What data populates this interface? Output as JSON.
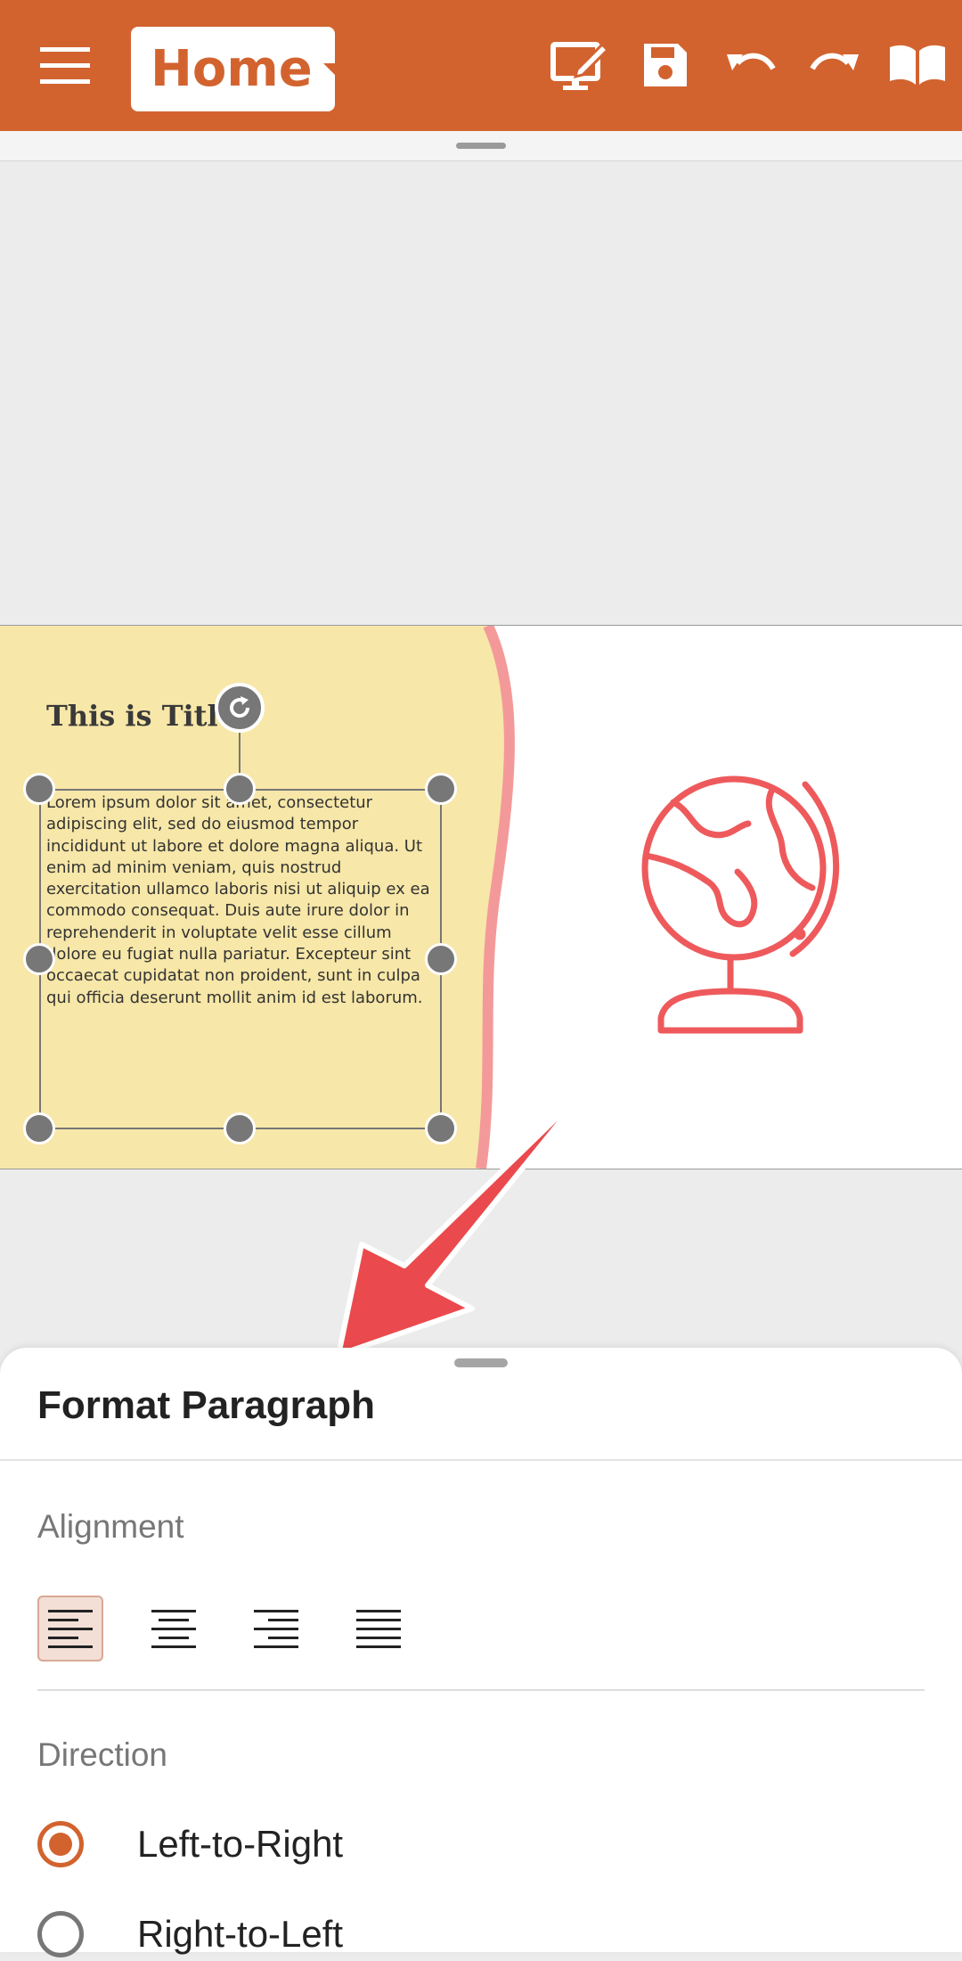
{
  "toolbar": {
    "home_label": "Home",
    "icons": [
      "menu-icon",
      "present-edit-icon",
      "save-icon",
      "undo-icon",
      "redo-icon",
      "read-mode-icon"
    ]
  },
  "slide": {
    "title": "This is Title",
    "body": "Lorem ipsum dolor sit amet, consectetur adipiscing elit, sed do eiusmod tempor incididunt ut labore et dolore magna aliqua. Ut enim ad minim veniam, quis nostrud exercitation ullamco laboris nisi ut aliquip ex ea commodo consequat. Duis aute irure dolor in reprehenderit in voluptate velit esse cillum dolore eu fugiat nulla pariatur. Excepteur sint occaecat cupidatat non proident, sunt in culpa qui officia deserunt mollit anim id est laborum.",
    "colors": {
      "panel": "#f7e7a8",
      "wave": "#f4999a",
      "globe": "#ee5a5c"
    }
  },
  "sheet": {
    "title": "Format Paragraph",
    "alignment_label": "Alignment",
    "alignment_options": [
      "align-left",
      "align-center",
      "align-right",
      "align-justify"
    ],
    "selected_alignment": "align-left",
    "direction_label": "Direction",
    "directions": [
      {
        "label": "Left-to-Right",
        "selected": true
      },
      {
        "label": "Right-to-Left",
        "selected": false
      }
    ]
  },
  "accent_color": "#d2632f"
}
